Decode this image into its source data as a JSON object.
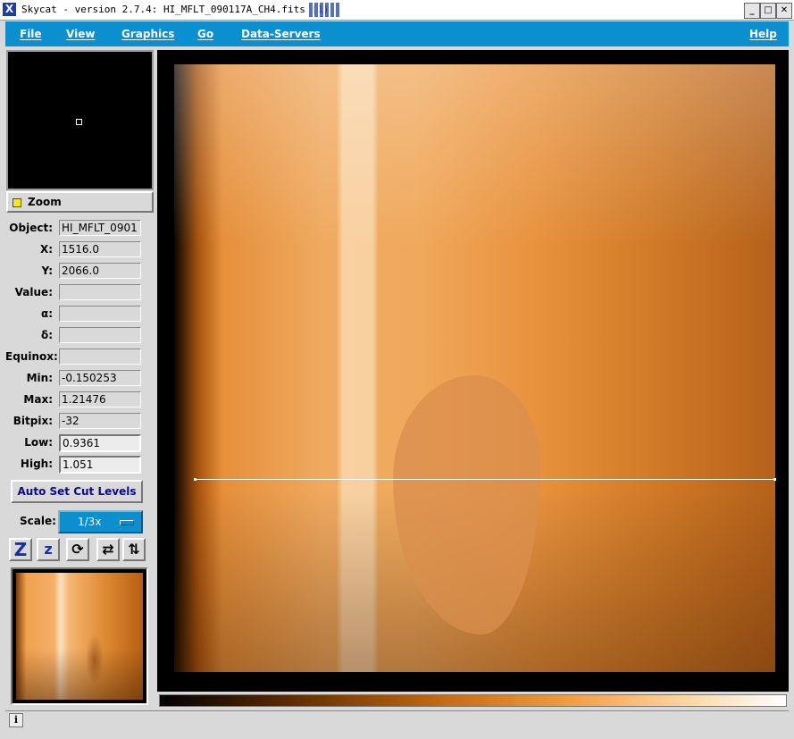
{
  "window": {
    "title": "Skycat - version 2.7.4: HI_MFLT_090117A_CH4.fits (1)",
    "app_icon": "X",
    "controls": [
      "_",
      "□",
      "✕"
    ]
  },
  "menu": {
    "items": [
      "File",
      "View",
      "Graphics",
      "Go",
      "Data-Servers"
    ],
    "help": "Help"
  },
  "zoom": {
    "label": "Zoom"
  },
  "info": [
    {
      "label": "Object:",
      "value": "HI_MFLT_0901"
    },
    {
      "label": "X:",
      "value": "1516.0"
    },
    {
      "label": "Y:",
      "value": "2066.0"
    },
    {
      "label": "Value:",
      "value": ""
    },
    {
      "label": "α:",
      "value": ""
    },
    {
      "label": "δ:",
      "value": ""
    },
    {
      "label": "Equinox:",
      "value": ""
    },
    {
      "label": "Min:",
      "value": "-0.150253"
    },
    {
      "label": "Max:",
      "value": "1.21476"
    },
    {
      "label": "Bitpix:",
      "value": "-32"
    },
    {
      "label": "Low:",
      "value": "0.9361"
    },
    {
      "label": "High:",
      "value": "1.051"
    }
  ],
  "auto_cut_label": "Auto Set Cut Levels",
  "scale": {
    "label": "Scale:",
    "value": "1/3x"
  },
  "tools": [
    {
      "name": "zoom-in",
      "glyph": "Z"
    },
    {
      "name": "zoom-out",
      "glyph": "z"
    },
    {
      "name": "rotate",
      "glyph": "⟳"
    },
    {
      "name": "flip-x",
      "glyph": "⇄"
    },
    {
      "name": "flip-y",
      "glyph": "⇅"
    }
  ],
  "status_icon": "i"
}
